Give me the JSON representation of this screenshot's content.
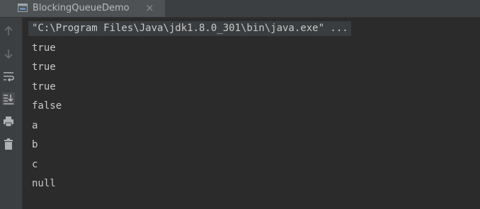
{
  "tab": {
    "title": "BlockingQueueDemo",
    "close_symbol": "×",
    "icon": "run-console-icon"
  },
  "gutter": {
    "icons": [
      "up-arrow-icon",
      "down-arrow-icon",
      "soft-wrap-icon",
      "scroll-to-end-icon",
      "print-icon",
      "trash-icon"
    ]
  },
  "console": {
    "command": "\"C:\\Program Files\\Java\\jdk1.8.0_301\\bin\\java.exe\" ...",
    "lines": [
      "true",
      "true",
      "true",
      "false",
      "a",
      "b",
      "c",
      "null"
    ]
  },
  "colors": {
    "background": "#2b2b2b",
    "panel": "#3c3f41",
    "text": "#c9c9c9"
  }
}
